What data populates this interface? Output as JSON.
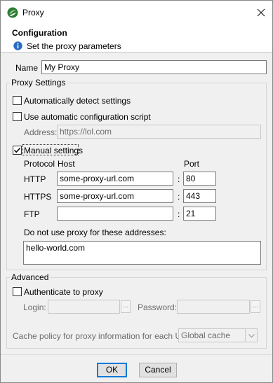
{
  "window": {
    "title": "Proxy",
    "close_icon": "close-icon",
    "app_icon": "app-logo-icon"
  },
  "header": {
    "title": "Configuration",
    "subtitle": "Set the proxy parameters",
    "icon": "info-icon"
  },
  "name_field": {
    "label": "Name",
    "value": "My Proxy"
  },
  "proxy_settings": {
    "title": "Proxy Settings",
    "auto_detect": {
      "label": "Automatically detect settings",
      "checked": false
    },
    "auto_config": {
      "label": "Use automatic configuration script",
      "checked": false
    },
    "address": {
      "label": "Address:",
      "value": "https://lol.com"
    },
    "manual": {
      "label": "Manual settings",
      "checked": true
    },
    "columns": {
      "protocol": "Protocol",
      "host": "Host",
      "port": "Port"
    },
    "rows": [
      {
        "protocol": "HTTP",
        "host": "some-proxy-url.com",
        "sep": ":",
        "port": "80"
      },
      {
        "protocol": "HTTPS",
        "host": "some-proxy-url.com",
        "sep": ":",
        "port": "443"
      },
      {
        "protocol": "FTP",
        "host": "",
        "sep": ":",
        "port": "21"
      }
    ],
    "bypass_label": "Do not use proxy for these addresses:",
    "bypass_value": "hello-world.com"
  },
  "advanced": {
    "title": "Advanced",
    "authenticate": {
      "label": "Authenticate to proxy",
      "checked": false
    },
    "login_label": "Login:",
    "login_value": "",
    "password_label": "Password:",
    "password_value": "",
    "ellipsis": "...",
    "cache_label": "Cache policy for proxy information for each URL",
    "cache_value": "Global cache"
  },
  "buttons": {
    "ok": "OK",
    "cancel": "Cancel"
  }
}
